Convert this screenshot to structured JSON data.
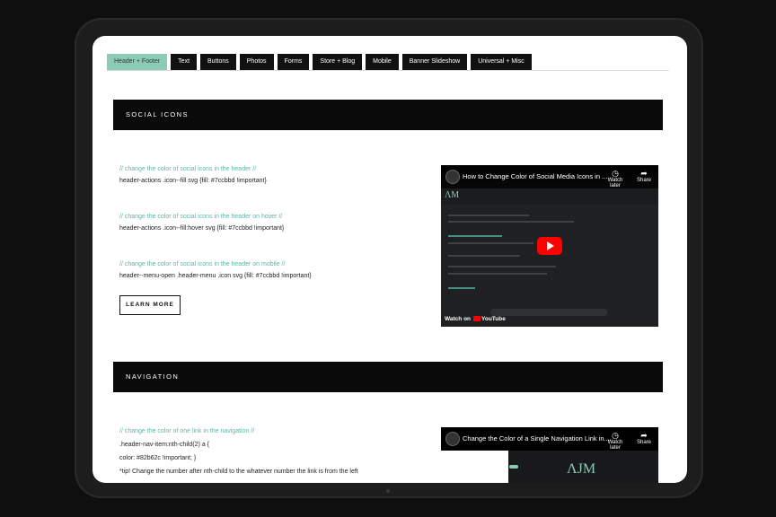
{
  "tabs": [
    {
      "label": "Header + Footer",
      "active": true
    },
    {
      "label": "Text",
      "active": false
    },
    {
      "label": "Buttons",
      "active": false
    },
    {
      "label": "Photos",
      "active": false
    },
    {
      "label": "Forms",
      "active": false
    },
    {
      "label": "Store + Blog",
      "active": false
    },
    {
      "label": "Mobile",
      "active": false
    },
    {
      "label": "Banner Slideshow",
      "active": false
    },
    {
      "label": "Universal + Misc",
      "active": false
    }
  ],
  "social": {
    "heading": "SOCIAL ICONS",
    "lines": [
      {
        "comment": "// change the color of social icons in the header //",
        "code": "header-actions .icon--fill svg {fill: #7ccbbd !important}"
      },
      {
        "comment": "// change the color of social icons in the header on hover //",
        "code": "header-actions .icon--fill:hover svg {fill: #7ccbbd !important}"
      },
      {
        "comment": "// change the color of social icons in the header on mobile //",
        "code": "header--menu-open .header-menu .icon svg {fill: #7ccbbd !important}"
      }
    ],
    "button": "LEARN MORE",
    "video": {
      "title": "How to Change Color of Social Media Icons in ...",
      "watch_later": "Watch later",
      "share": "Share",
      "watch_on": "Watch on",
      "youtube": "YouTube"
    }
  },
  "navigation": {
    "heading": "NAVIGATION",
    "comment": "// change the color of one link in the navigation //",
    "code1": ".header-nav-item:nth-child(2) a {",
    "code2": "color: #82b62c !important; }",
    "tip": "*tip! Change the number after nth-child to the whatever number the link is from the left",
    "video": {
      "title": "Change the Color of a Single Navigation Link in...",
      "watch_later": "Watch later",
      "share": "Share"
    }
  },
  "colors": {
    "accent": "#8ccbb6",
    "banner": "#0a0a0a"
  }
}
